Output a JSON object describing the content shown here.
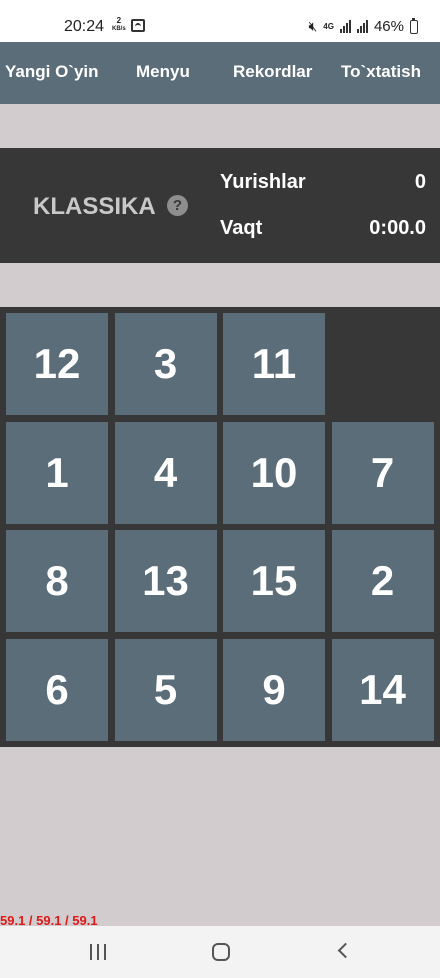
{
  "status_bar": {
    "time": "20:24",
    "net_speed_value": "2",
    "net_speed_unit": "KB/s",
    "network_type": "4G",
    "battery": "46%"
  },
  "menu": {
    "new_game": "Yangi O`yin",
    "menu": "Menyu",
    "records": "Rekordlar",
    "stop": "To`xtatish"
  },
  "info": {
    "mode": "KLASSIKA",
    "help": "?",
    "moves_label": "Yurishlar",
    "moves_value": "0",
    "time_label": "Vaqt",
    "time_value": "0:00.0"
  },
  "board": {
    "size": 4,
    "tiles": [
      [
        12,
        3,
        11,
        null
      ],
      [
        1,
        4,
        10,
        7
      ],
      [
        8,
        13,
        15,
        2
      ],
      [
        6,
        5,
        9,
        14
      ]
    ]
  },
  "fps_text": "59.1 / 59.1 / 59.1",
  "colors": {
    "background": "#d2cccf",
    "menubar": "#5a6d78",
    "panel": "#373737",
    "tile": "#5a6d78",
    "fps": "#e01818"
  }
}
